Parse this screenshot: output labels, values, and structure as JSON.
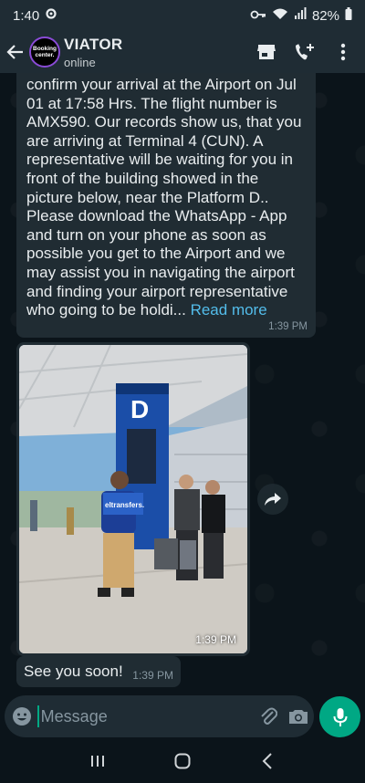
{
  "status_bar": {
    "time": "1:40",
    "battery": "82%"
  },
  "header": {
    "contact_name": "VIATOR",
    "contact_status": "online",
    "avatar_text": "Booking center."
  },
  "messages": [
    {
      "text": "confirm your arrival at the Airport on Jul 01 at 17:58 Hrs. The flight number is AMX590. Our records show us, that you are arriving at Terminal 4 (CUN). A representative will be waiting for you in front of the building showed in the picture below, near the Platform D.. Please download the WhatsApp - App and turn on your phone as soon as possible you get to the Airport and we may assist you in navigating the airport and finding your airport representative who going to be holdi... ",
      "read_more": "Read more",
      "time": "1:39 PM"
    },
    {
      "type": "image",
      "sign_letter": "D",
      "board_text": "eltransfers.",
      "time": "1:39 PM"
    },
    {
      "text": "See you soon!",
      "time": "1:39 PM"
    }
  ],
  "composer": {
    "placeholder": "Message"
  },
  "icons": {
    "back": "arrow-left-icon",
    "store": "storefront-icon",
    "call": "add-call-icon",
    "menu": "more-vertical-icon",
    "emoji": "emoji-icon",
    "attach": "paperclip-icon",
    "camera": "camera-icon",
    "mic": "mic-icon",
    "forward": "forward-icon"
  },
  "colors": {
    "accent": "#00a884",
    "link": "#53bdeb",
    "bubble": "#202c33",
    "background": "#0b141a"
  }
}
